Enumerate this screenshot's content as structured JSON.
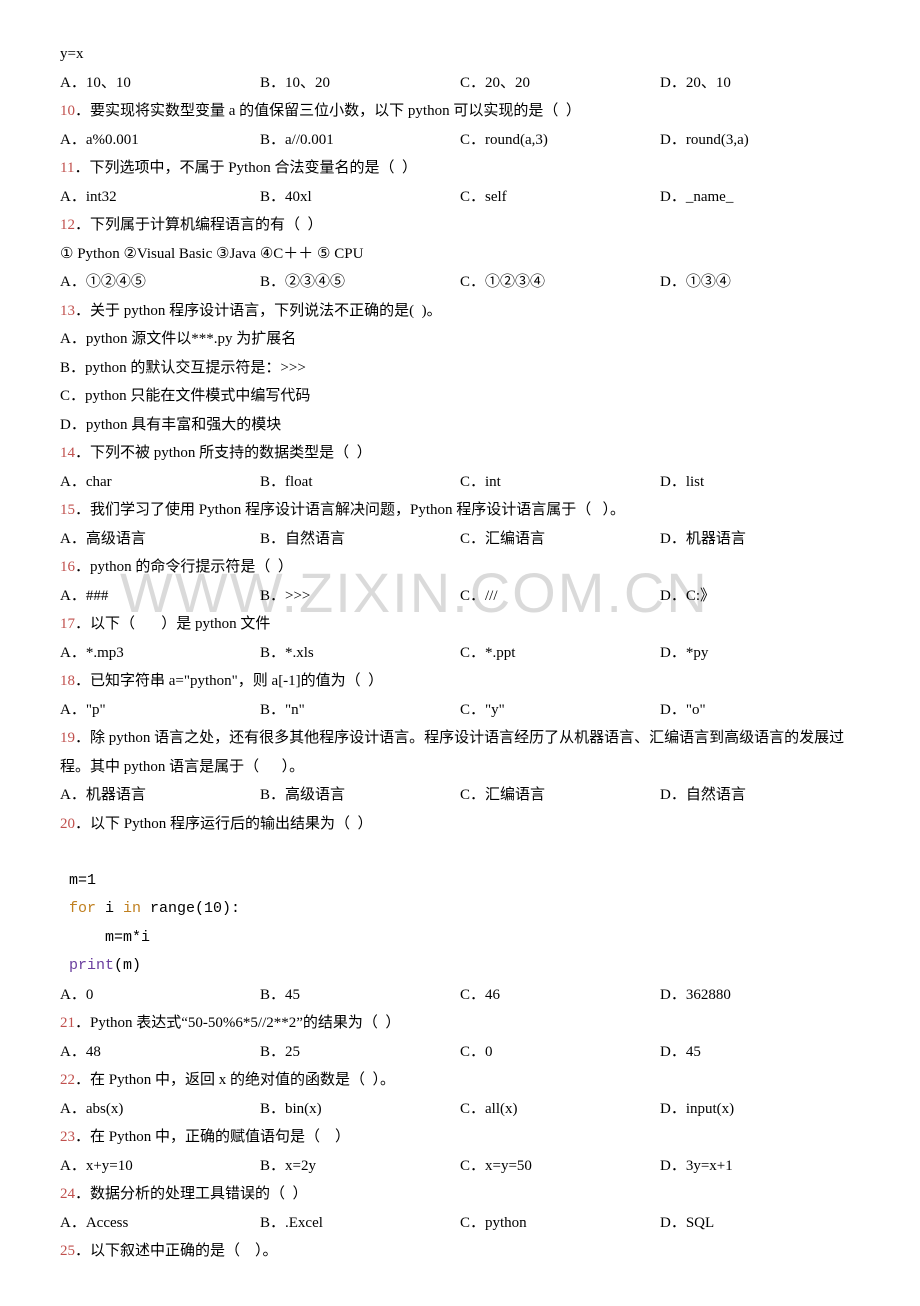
{
  "pre": "y=x",
  "q9": {
    "a": "A．10、10",
    "b": "B．10、20",
    "c": "C．20、20",
    "d": "D．20、10"
  },
  "q10": {
    "num": "10",
    "text": "．要实现将实数型变量 a 的值保留三位小数，以下 python 可以实现的是（  ）",
    "a": "A．a%0.001",
    "b": "B．a//0.001",
    "c": "C．round(a,3)",
    "d": "D．round(3,a)"
  },
  "q11": {
    "num": "11",
    "text": "．下列选项中，不属于 Python 合法变量名的是（  ）",
    "a": "A．int32",
    "b": "B．40xl",
    "c": "C．self",
    "d": "D．_name_"
  },
  "q12": {
    "num": "12",
    "text": "．下列属于计算机编程语言的有（  ）",
    "sub": "① Python ②Visual Basic ③Java ④C＋＋ ⑤ CPU",
    "a": "A．①②④⑤",
    "b": "B．②③④⑤",
    "c": "C．①②③④",
    "d": "D．①③④"
  },
  "q13": {
    "num": "13",
    "text": "．关于 python 程序设计语言，下列说法不正确的是(  )。",
    "a": "A．python 源文件以***.py 为扩展名",
    "b": "B．python 的默认交互提示符是：>>>",
    "c": "C．python 只能在文件模式中编写代码",
    "d": "D．python 具有丰富和强大的模块"
  },
  "q14": {
    "num": "14",
    "text": "．下列不被 python 所支持的数据类型是（  ）",
    "a": "A．char",
    "b": "B．float",
    "c": "C．int",
    "d": "D．list"
  },
  "q15": {
    "num": "15",
    "text": "．我们学习了使用 Python 程序设计语言解决问题，Python 程序设计语言属于（   ）。",
    "a": "A．高级语言",
    "b": "B．自然语言",
    "c": "C．汇编语言",
    "d": "D．机器语言"
  },
  "q16": {
    "num": "16",
    "text": "．python 的命令行提示符是（  ）",
    "a": "A．###",
    "b": "B．>>>",
    "c": "C．///",
    "d": "D．C:》"
  },
  "q17": {
    "num": "17",
    "text": "．以下（       ）是 python 文件",
    "a": "A．*.mp3",
    "b": "B．*.xls",
    "c": "C．*.ppt",
    "d": "D．*py"
  },
  "q18": {
    "num": "18",
    "text": "．已知字符串 a=\"python\"，则 a[-1]的值为（  ）",
    "a": "A．\"p\"",
    "b": "B．\"n\"",
    "c": "C．\"y\"",
    "d": "D．\"o\""
  },
  "q19": {
    "num": "19",
    "text": "．除 python 语言之处，还有很多其他程序设计语言。程序设计语言经历了从机器语言、汇编语言到高级语言的发展过程。其中 python 语言是属于（      ）。",
    "a": "A．机器语言",
    "b": "B．高级语言",
    "c": "C．汇编语言",
    "d": "D．自然语言"
  },
  "q20": {
    "num": "20",
    "text": "．以下 Python 程序运行后的输出结果为（  ）",
    "code1": " m=1",
    "code2a": " for",
    "code2b": " i ",
    "code2c": "in",
    "code2d": " range(10):",
    "code3": "     m=m*i",
    "code4a": " print",
    "code4b": "(m)",
    "a": "A．0",
    "b": "B．45",
    "c": "C．46",
    "d": "D．362880"
  },
  "q21": {
    "num": "21",
    "text": "．Python 表达式“50-50%6*5//2**2”的结果为（  ）",
    "a": "A．48",
    "b": "B．25",
    "c": "C．0",
    "d": "D．45"
  },
  "q22": {
    "num": "22",
    "text": "．在 Python 中，返回 x 的绝对值的函数是（  ）。",
    "a": "A．abs(x)",
    "b": "B．bin(x)",
    "c": "C．all(x)",
    "d": "D．input(x)"
  },
  "q23": {
    "num": "23",
    "text": "．在 Python 中，正确的赋值语句是（    ）",
    "a": "A．x+y=10",
    "b": "B．x=2y",
    "c": "C．x=y=50",
    "d": "D．3y=x+1"
  },
  "q24": {
    "num": "24",
    "text": "．数据分析的处理工具错误的（  ）",
    "a": "A．Access",
    "b": "B．.Excel",
    "c": "C．python",
    "d": "D．SQL"
  },
  "q25": {
    "num": "25",
    "text": "．以下叙述中正确的是（    ）。"
  },
  "watermark": "WWW.ZIXIN.COM.CN"
}
